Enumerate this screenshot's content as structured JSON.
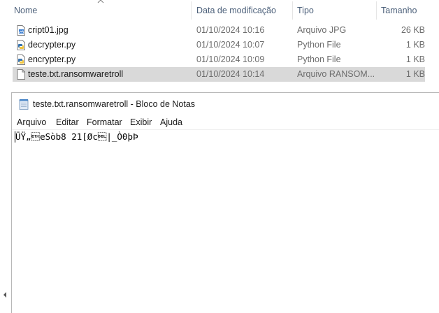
{
  "explorer": {
    "columns": {
      "name": "Nome",
      "date": "Data de modificação",
      "type": "Tipo",
      "size": "Tamanho"
    },
    "files": [
      {
        "name": "cript01.jpg",
        "date": "01/10/2024 10:16",
        "type": "Arquivo JPG",
        "size": "26 KB",
        "icon": "image-file-icon"
      },
      {
        "name": "decrypter.py",
        "date": "01/10/2024 10:07",
        "type": "Python File",
        "size": "1 KB",
        "icon": "python-file-icon"
      },
      {
        "name": "encrypter.py",
        "date": "01/10/2024 10:09",
        "type": "Python File",
        "size": "1 KB",
        "icon": "python-file-icon"
      },
      {
        "name": "teste.txt.ransomwaretroll",
        "date": "01/10/2024 10:14",
        "type": "Arquivo RANSOM...",
        "size": "1 KB",
        "icon": "generic-file-icon",
        "selected": true
      }
    ],
    "selection_color": "#d9d9d9"
  },
  "notepad": {
    "title": "teste.txt.ransomwaretroll - Bloco de Notas",
    "menu": [
      "Arquivo",
      "Editar",
      "Formatar",
      "Exibir",
      "Ajuda"
    ],
    "content": "ÜŸ„\u0003eSòb8 21[Øc\u0007|_Ò0þÞ"
  }
}
